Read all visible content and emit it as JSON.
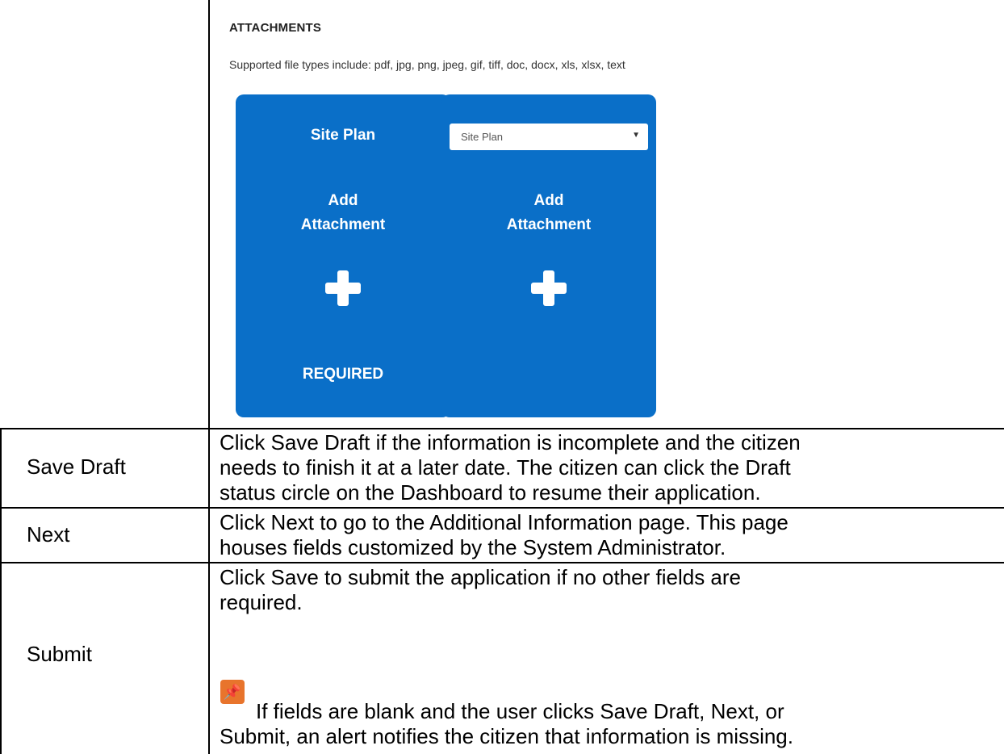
{
  "screenshot": {
    "section_title": "ATTACHMENTS",
    "supported_types": "Supported file types include: pdf, jpg, png, jpeg, gif, tiff, doc, docx, xls, xlsx, text",
    "card_left": {
      "title": "Site Plan",
      "add_line1": "Add",
      "add_line2": "Attachment",
      "status": "REQUIRED"
    },
    "card_right": {
      "select_value": "Site Plan",
      "add_line1": "Add",
      "add_line2": "Attachment"
    },
    "card_color": "#0a6fc8"
  },
  "rows": [
    {
      "label": "Save Draft",
      "desc_lines": [
        "Click Save Draft if the information is incomplete and the citizen",
        "needs to finish it at a later date. The citizen can click the Draft",
        "status circle on the Dashboard to resume their application."
      ]
    },
    {
      "label": "Next",
      "desc_lines": [
        "Click Next to go to the Additional Information page. This page",
        "houses fields customized by the System Administrator."
      ]
    },
    {
      "label": "Submit",
      "desc_lines": [
        "Click Save to submit the application if no other fields are",
        "required."
      ],
      "note_lines": [
        "If fields are blank and the user clicks Save Draft, Next, or",
        "Submit, an alert notifies the citizen that information is missing."
      ],
      "note_icon": "pushpin-icon"
    }
  ]
}
